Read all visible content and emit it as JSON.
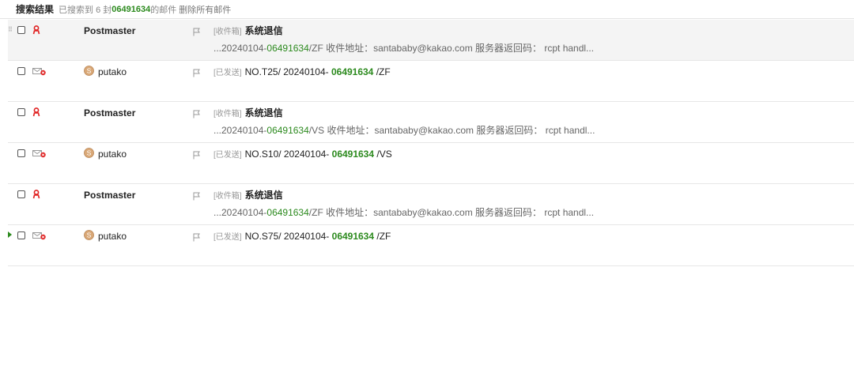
{
  "header": {
    "title": "搜索结果",
    "found_prefix": "已搜索到 6 封",
    "keyword": "06491634",
    "found_suffix": "的邮件",
    "delete_all": "删除所有邮件"
  },
  "colors": {
    "keyword_green": "#2c8a1e",
    "bounce_red": "#e02020",
    "avatar_orange": "#d9a877"
  },
  "emails": [
    {
      "sender": "Postmaster",
      "folder": "[收件箱]",
      "subject": "系统退信",
      "snippet": {
        "pre": "...20240104-",
        "kw": "06491634",
        "post": "/ZF 收件地址：santababy@kakao.com 服务器返回码： rcpt handl..."
      },
      "icon": "bounce-icon"
    },
    {
      "sender": "putako",
      "folder": "[已发送]",
      "subject": {
        "pre": "NO.T25/ 20240104- ",
        "kw": "06491634",
        "post": " /ZF"
      },
      "icon": "sent-mail-icon"
    },
    {
      "sender": "Postmaster",
      "folder": "[收件箱]",
      "subject": "系统退信",
      "snippet": {
        "pre": "...20240104-",
        "kw": "06491634",
        "post": "/VS 收件地址：santababy@kakao.com 服务器返回码： rcpt handl..."
      },
      "icon": "bounce-icon"
    },
    {
      "sender": "putako",
      "folder": "[已发送]",
      "subject": {
        "pre": "NO.S10/ 20240104- ",
        "kw": "06491634",
        "post": " /VS"
      },
      "icon": "sent-mail-icon"
    },
    {
      "sender": "Postmaster",
      "folder": "[收件箱]",
      "subject": "系统退信",
      "snippet": {
        "pre": "...20240104-",
        "kw": "06491634",
        "post": "/ZF 收件地址：santababy@kakao.com 服务器返回码： rcpt handl..."
      },
      "icon": "bounce-icon"
    },
    {
      "sender": "putako",
      "folder": "[已发送]",
      "subject": {
        "pre": "NO.S75/ 20240104- ",
        "kw": "06491634",
        "post": " /ZF"
      },
      "icon": "sent-mail-icon"
    }
  ]
}
